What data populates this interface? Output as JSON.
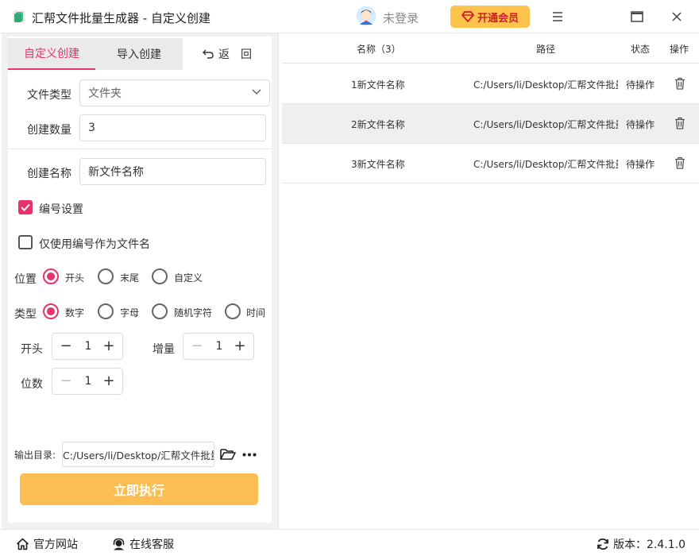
{
  "window": {
    "title": "汇帮文件批量生成器 - 自定义创建",
    "login_text": "未登录",
    "vip_label": "开通会员"
  },
  "tabs": {
    "custom": "自定义创建",
    "import": "导入创建",
    "back": "返　回"
  },
  "form": {
    "file_type_label": "文件类型",
    "file_type_value": "文件夹",
    "count_label": "创建数量",
    "count_value": "3",
    "name_label": "创建名称",
    "name_value": "新文件名称",
    "numbering_label": "编号设置",
    "numbering_checked": true,
    "use_number_only_label": "仅使用编号作为文件名",
    "use_number_only_checked": false,
    "position_label": "位置",
    "position_options": [
      "开头",
      "末尾",
      "自定义"
    ],
    "position_selected": "开头",
    "type_label": "类型",
    "type_options": [
      "数字",
      "字母",
      "随机字符",
      "时间"
    ],
    "type_selected": "数字",
    "start_label": "开头",
    "start_value": "1",
    "increment_label": "增量",
    "increment_value": "1",
    "digits_label": "位数",
    "digits_value": "1",
    "output_label": "输出目录:",
    "output_value": "C:/Users/li/Desktop/汇帮文件批量生成器",
    "execute_label": "立即执行"
  },
  "table": {
    "headers": {
      "name": "名称（3）",
      "path": "路径",
      "status": "状态",
      "action": "操作"
    },
    "rows": [
      {
        "name": "1新文件名称",
        "path": "C:/Users/li/Desktop/汇帮文件批量生成器",
        "status": "待操作"
      },
      {
        "name": "2新文件名称",
        "path": "C:/Users/li/Desktop/汇帮文件批量生成器",
        "status": "待操作"
      },
      {
        "name": "3新文件名称",
        "path": "C:/Users/li/Desktop/汇帮文件批量生成器",
        "status": "待操作"
      }
    ]
  },
  "statusbar": {
    "website": "官方网站",
    "support": "在线客服",
    "version": "版本：2.4.1.0"
  },
  "colors": {
    "accent": "#e6336c",
    "execute_button": "#fbbe52",
    "vip_button": "#fdc34a"
  },
  "icons": [
    "app-icon",
    "avatar-icon",
    "diamond-icon",
    "menu-icon",
    "maximize-icon",
    "close-icon",
    "back-arrow-icon",
    "chevron-down-icon",
    "checkbox-checked-icon",
    "folder-open-icon",
    "more-icon",
    "trash-icon",
    "home-icon",
    "headset-icon",
    "refresh-icon"
  ]
}
